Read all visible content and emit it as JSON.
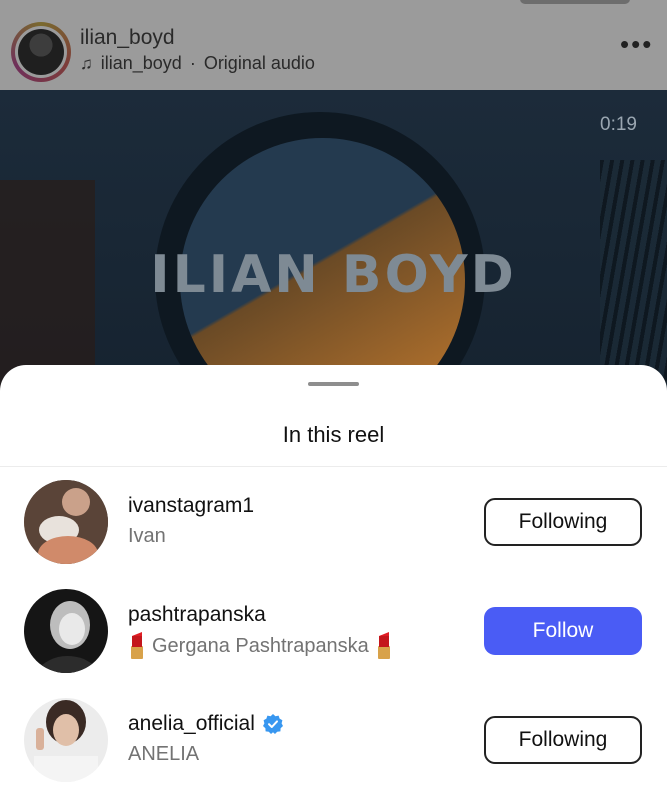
{
  "post": {
    "author": "ilian_boyd",
    "audio_author": "ilian_boyd",
    "audio_separator": "·",
    "audio_label": "Original audio",
    "more_icon": "more-options-icon"
  },
  "video": {
    "timestamp": "0:19",
    "overlay_title": "ILIAN BOYD"
  },
  "sheet": {
    "title": "In this reel",
    "people": [
      {
        "username": "ivanstagram1",
        "display_name": "Ivan",
        "verified": false,
        "button": "Following",
        "button_style": "following"
      },
      {
        "username": "pashtrapanska",
        "display_name": "Gergana Pashtrapanska",
        "name_decoration_icon": "lipstick-icon",
        "verified": false,
        "button": "Follow",
        "button_style": "follow"
      },
      {
        "username": "anelia_official",
        "display_name": "ANELIA",
        "verified": true,
        "button": "Following",
        "button_style": "following"
      }
    ]
  },
  "colors": {
    "follow_button": "#4a5cf5",
    "verified_badge": "#3897f0",
    "secondary_text": "#737373"
  }
}
